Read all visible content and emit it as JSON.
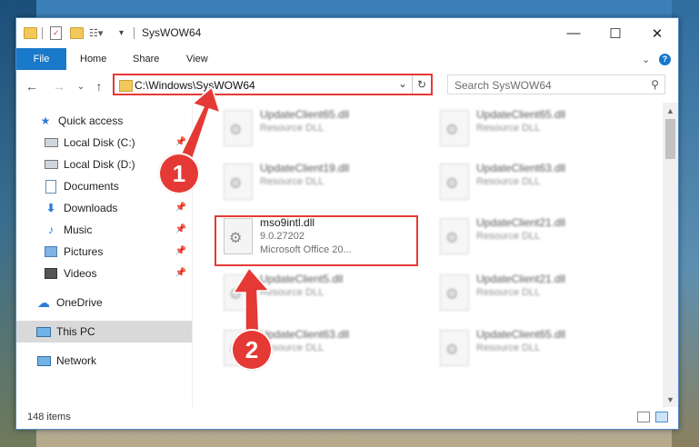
{
  "window": {
    "title": "SysWOW64",
    "controls": {
      "minimize": "—",
      "maximize": "☐",
      "close": "✕"
    }
  },
  "ribbon": {
    "file_label": "File",
    "tabs": [
      "Home",
      "Share",
      "View"
    ],
    "expand_icon": "chevron-down-icon",
    "help_icon": "help-icon"
  },
  "address": {
    "path": "C:\\Windows\\SysWOW64",
    "search_placeholder": "Search SysWOW64"
  },
  "nav": {
    "items": [
      {
        "label": "Quick access",
        "icon": "star-icon",
        "pinned": false
      },
      {
        "label": "Local Disk (C:)",
        "icon": "drive-icon",
        "pinned": true
      },
      {
        "label": "Local Disk (D:)",
        "icon": "drive-icon",
        "pinned": false
      },
      {
        "label": "Documents",
        "icon": "documents-icon",
        "pinned": true
      },
      {
        "label": "Downloads",
        "icon": "downloads-icon",
        "pinned": true
      },
      {
        "label": "Music",
        "icon": "music-icon",
        "pinned": true
      },
      {
        "label": "Pictures",
        "icon": "pictures-icon",
        "pinned": true
      },
      {
        "label": "Videos",
        "icon": "videos-icon",
        "pinned": true
      },
      {
        "label": "OneDrive",
        "icon": "cloud-icon",
        "pinned": false
      },
      {
        "label": "This PC",
        "icon": "computer-icon",
        "pinned": false,
        "selected": true
      },
      {
        "label": "Network",
        "icon": "network-icon",
        "pinned": false
      }
    ]
  },
  "files": [
    {
      "name": "UpdateClient65.dll",
      "type": "Resource DLL"
    },
    {
      "name": "UpdateClient65.dll",
      "type": "Resource DLL"
    },
    {
      "name": "UpdateClient19.dll",
      "type": "Resource DLL"
    },
    {
      "name": "UpdateClient63.dll",
      "type": "Resource DLL"
    },
    {
      "name": "mso9intl.dll",
      "version": "9.0.27202",
      "company": "Microsoft Office 20...",
      "highlighted": true
    },
    {
      "name": "UpdateClient21.dll",
      "type": "Resource DLL"
    },
    {
      "name": "UpdateClient5.dll",
      "type": "Resource DLL"
    },
    {
      "name": "UpdateClient21.dll",
      "type": "Resource DLL"
    },
    {
      "name": "UpdateClient63.dll",
      "type": "Resource DLL"
    },
    {
      "name": "UpdateClient65.dll",
      "type": "Resource DLL"
    }
  ],
  "status": {
    "item_count": "148 items"
  },
  "annotations": {
    "badge1": "1",
    "badge2": "2",
    "accent": "#e53935"
  }
}
